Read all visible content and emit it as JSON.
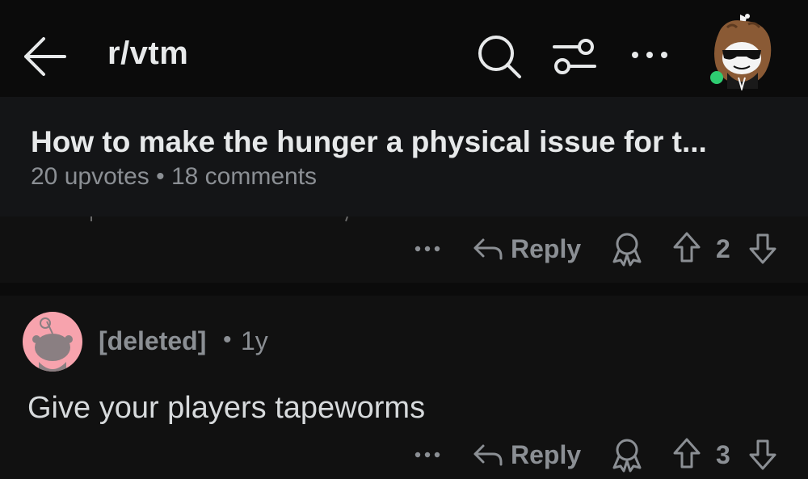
{
  "topbar": {
    "subreddit": "r/vtm",
    "icons": [
      "back-arrow-icon",
      "search-icon",
      "filter-icon",
      "more-icon",
      "user-avatar"
    ],
    "online_color": "#2ecc71"
  },
  "post": {
    "title": "How to make the hunger a physical issue for t...",
    "meta": "20 upvotes • 18 comments"
  },
  "comments": [
    {
      "reply_label": "Reply",
      "score": "2"
    },
    {
      "author": "[deleted]",
      "separator": "•",
      "age": "1y",
      "body": "Give your players tapeworms",
      "reply_label": "Reply",
      "score": "3"
    }
  ],
  "colors": {
    "background": "#0b0b0b",
    "header_bg": "#141517",
    "comment_bg": "#111111",
    "muted_text": "#8b8f94",
    "primary_text": "#e7e9ea",
    "deleted_avatar_bg": "#f7a3ad"
  }
}
